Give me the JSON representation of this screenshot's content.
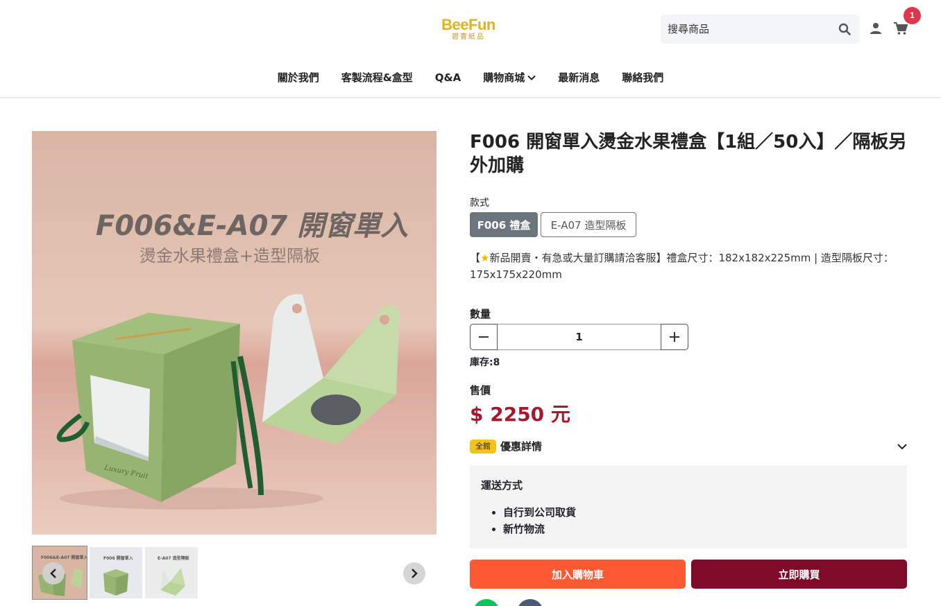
{
  "header": {
    "logo_main": "BeeFun",
    "logo_sub": "碧曹紙品",
    "search_placeholder": "搜尋商品",
    "cart_count": "1",
    "nav": [
      {
        "label": "關於我們"
      },
      {
        "label": "客製流程&盒型"
      },
      {
        "label": "Q&A"
      },
      {
        "label": "購物商城"
      },
      {
        "label": "最新消息"
      },
      {
        "label": "聯絡我們"
      }
    ]
  },
  "gallery": {
    "main_image": {
      "headline": "F006&E-A07  開窗單入",
      "subline": "燙金水果禮盒+造型隔板",
      "box_script": "Luxury Fruit"
    },
    "thumbnails": [
      {
        "caption": "F006&E-A07 開窗單入"
      },
      {
        "caption": "F006 開窗單入"
      },
      {
        "caption": "E-A07 造型隔板"
      }
    ]
  },
  "product": {
    "title": "F006 開窗單入燙金水果禮盒【1組／50入】／隔板另外加購",
    "variant_label": "款式",
    "variants": [
      {
        "label": "F006 禮盒",
        "selected": true
      },
      {
        "label": "E-A07 造型隔板",
        "selected": false
      }
    ],
    "description_prefix": "【",
    "description": "新品開賣・有急或大量訂購請洽客服】禮盒尺寸：182x182x225mm | 造型隔板尺寸：175x175x220mm",
    "quantity_label": "數量",
    "quantity": "1",
    "stock": "庫存:8",
    "price_label": "售價",
    "price": "$ 2250 元",
    "promo_badge": "全館",
    "promo_text": "優惠詳情",
    "shipping_title": "運送方式",
    "shipping_methods": [
      "自行到公司取貨",
      "新竹物流"
    ],
    "add_to_cart": "加入購物車",
    "buy_now": "立即購買"
  },
  "colors": {
    "add_to_cart": "#fd5a33",
    "buy_now": "#7f0a27",
    "price": "#a8172b",
    "badge": "#e0364b",
    "promo_badge": "#f3c21b"
  }
}
